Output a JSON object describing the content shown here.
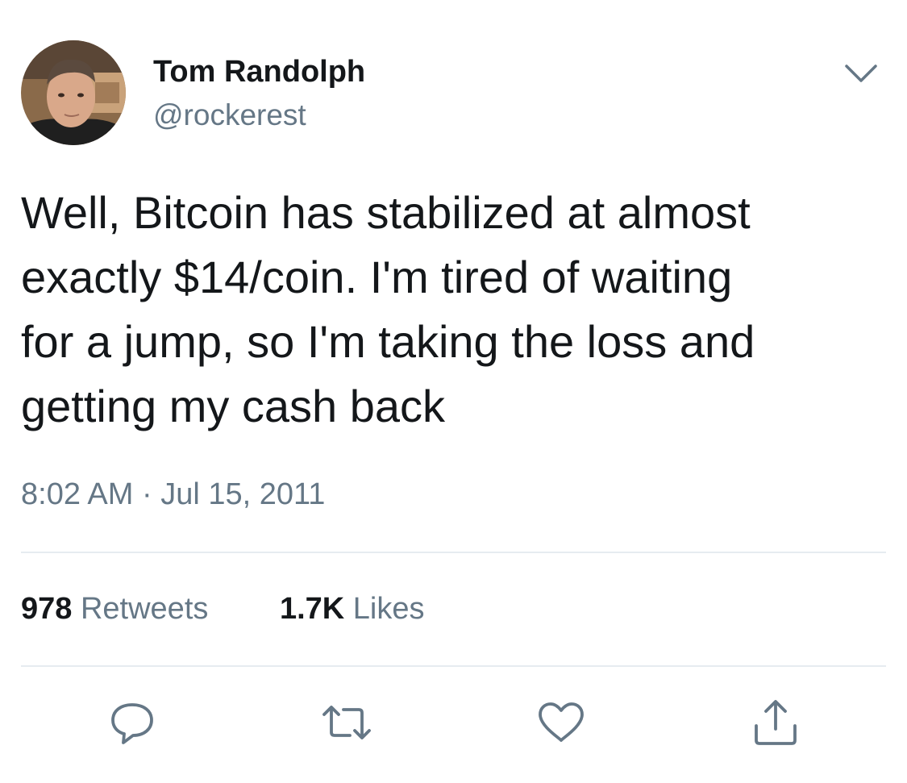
{
  "author": {
    "display_name": "Tom Randolph",
    "handle": "@rockerest",
    "avatar_icon": "avatar-photo"
  },
  "tweet": {
    "text": "Well, Bitcoin has stabilized at almost\nexactly $14/coin.  I'm tired of waiting\nfor a jump, so I'm taking the loss and\ngetting my cash back",
    "time": "8:02 AM",
    "separator": "·",
    "date": "Jul 15, 2011"
  },
  "stats": {
    "retweets_count": "978",
    "retweets_label": "Retweets",
    "likes_count": "1.7K",
    "likes_label": "Likes"
  },
  "actions": {
    "icons": [
      "reply-icon",
      "retweet-icon",
      "like-icon",
      "share-icon"
    ],
    "caret_icon": "chevron-down-icon"
  },
  "colors": {
    "text_primary": "#14171a",
    "text_secondary": "#657786",
    "divider": "#e6ecf0",
    "icon_gray": "#657786"
  }
}
